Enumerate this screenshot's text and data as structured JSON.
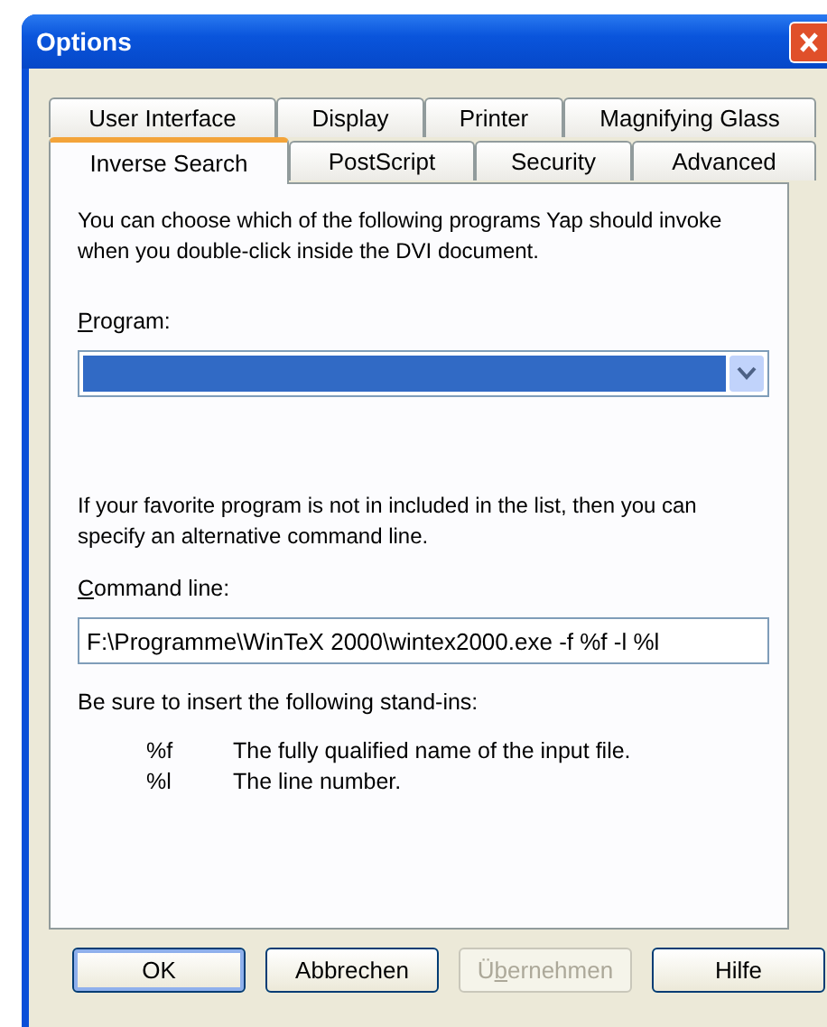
{
  "window": {
    "title": "Options"
  },
  "tab_rows": [
    [
      {
        "label": "User Interface",
        "selected": false
      },
      {
        "label": "Display",
        "selected": false
      },
      {
        "label": "Printer",
        "selected": false
      },
      {
        "label": "Magnifying Glass",
        "selected": false
      }
    ],
    [
      {
        "label": "Inverse Search",
        "selected": true
      },
      {
        "label": "PostScript",
        "selected": false
      },
      {
        "label": "Security",
        "selected": false
      },
      {
        "label": "Advanced",
        "selected": false
      }
    ]
  ],
  "intro": "You can choose which of the following programs Yap should invoke when you double-click inside the DVI document.",
  "program": {
    "label": {
      "key": "P",
      "after": "rogram:"
    }
  },
  "note": "If your favorite program is not in included in the list, then you can specify an alternative command line.",
  "command_line": {
    "label": {
      "key": "C",
      "after": "ommand line:"
    },
    "value": "F:\\Programme\\WinTeX 2000\\wintex2000.exe -f %f -l %l"
  },
  "standins_intro": "Be sure to insert the following stand-ins:",
  "standins": [
    {
      "code": "%f",
      "description": "The fully qualified name of the input file."
    },
    {
      "code": "%l",
      "description": "The line number."
    }
  ],
  "buttons": [
    {
      "label": "OK",
      "default": true,
      "disabled": false
    },
    {
      "label": "Abbrechen",
      "default": false,
      "disabled": false
    },
    {
      "label": {
        "before": "Ü",
        "key": "b",
        "after": "ernehmen"
      },
      "default": false,
      "disabled": true
    },
    {
      "label": "Hilfe",
      "default": false,
      "disabled": false
    }
  ]
}
